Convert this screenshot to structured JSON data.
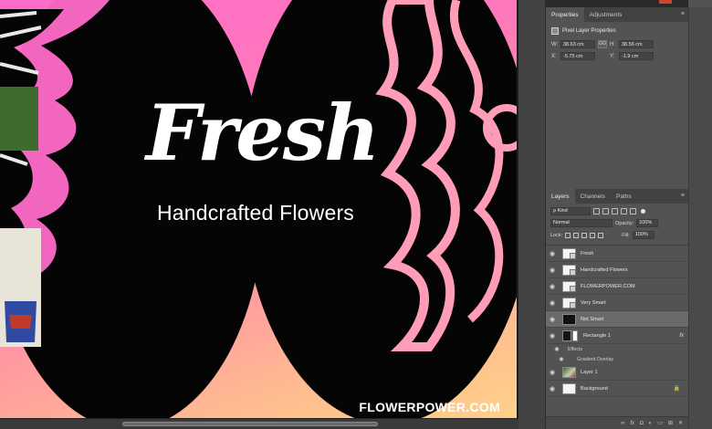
{
  "canvas": {
    "title": "Fresh",
    "subtitle": "Handcrafted Flowers",
    "url": "FLOWERPOWER.COM"
  },
  "properties_panel": {
    "tabs": [
      "Properties",
      "Adjustments"
    ],
    "header": "Pixel Layer Properties",
    "width_label": "W:",
    "width_value": "38.63 cm",
    "link_label": "GO",
    "height_label": "H:",
    "height_value": "38.56 cm",
    "x_label": "X:",
    "x_value": "-5.75 cm",
    "y_label": "Y:",
    "y_value": "-1.9 cm"
  },
  "layers_panel": {
    "tabs": [
      "Layers",
      "Channels",
      "Paths"
    ],
    "filter_kind": "ρ Kind",
    "blend_mode": "Normal",
    "opacity_label": "Opacity:",
    "opacity_value": "100%",
    "lock_label": "Lock:",
    "fill_label": "Fill:",
    "fill_value": "100%",
    "layers": [
      {
        "name": "Fresh"
      },
      {
        "name": "Handcrafted Flowers"
      },
      {
        "name": "FLOWERPOWER.COM"
      },
      {
        "name": "Very Smart"
      },
      {
        "name": "Not Smart"
      },
      {
        "name": "Rectangle 1",
        "fx": "fx"
      },
      {
        "name": "Effects"
      },
      {
        "name": "Gradient Overlay"
      },
      {
        "name": "Layer 1"
      },
      {
        "name": "Background"
      }
    ],
    "footer_icons": [
      "link-icon",
      "fx-icon",
      "mask-icon",
      "adjustment-icon",
      "group-icon",
      "new-layer-icon",
      "trash-icon"
    ]
  }
}
